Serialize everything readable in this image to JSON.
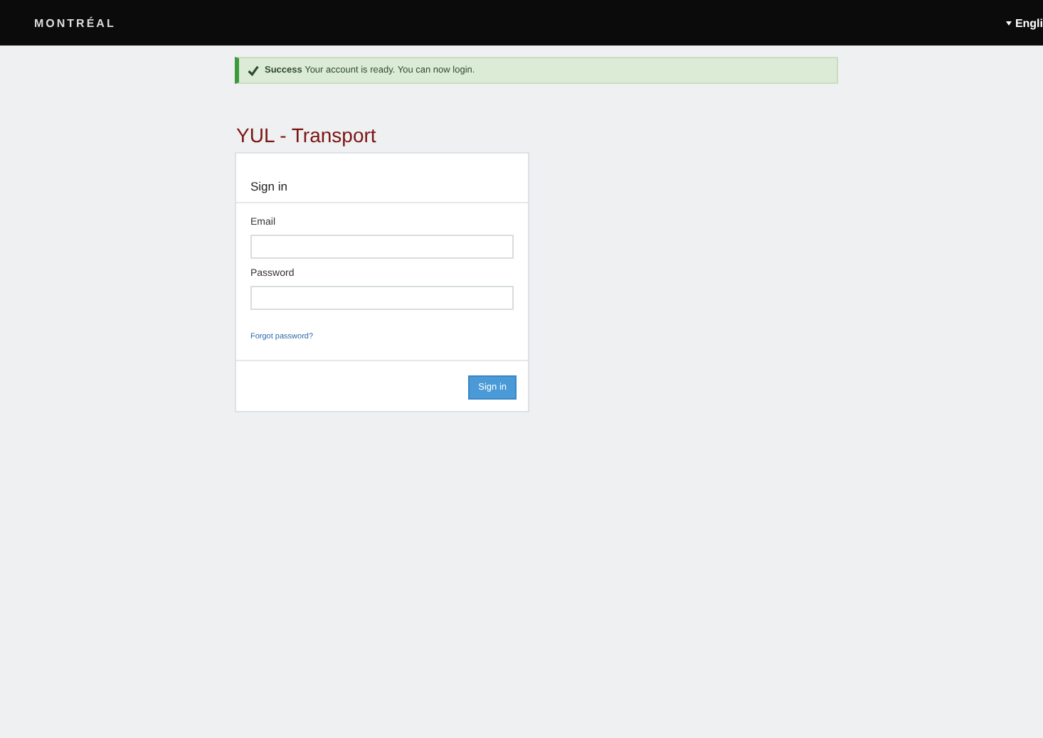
{
  "header": {
    "logo": "MONTRÉAL",
    "language": "Engli"
  },
  "alert": {
    "strong": "Success",
    "message": "Your account is ready.  You can now login."
  },
  "title": "YUL - Transport",
  "panel": {
    "heading": "Sign in",
    "fields": [
      {
        "label": "Email"
      },
      {
        "label": "Password"
      }
    ],
    "link": "Forgot password?",
    "button": "Sign in"
  }
}
